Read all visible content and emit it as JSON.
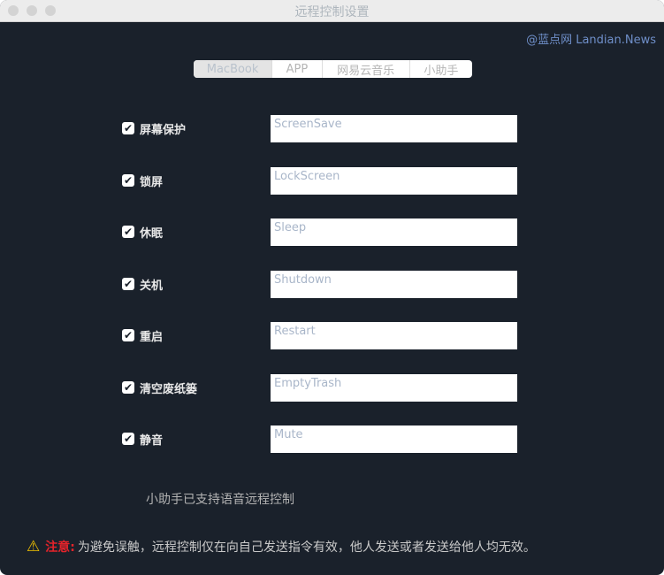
{
  "window": {
    "title": "远程控制设置"
  },
  "watermark": "@蓝点网 Landian.News",
  "tabs": [
    {
      "label": "MacBook",
      "active": true
    },
    {
      "label": "APP"
    },
    {
      "label": "网易云音乐"
    },
    {
      "label": "小助手"
    }
  ],
  "rows": [
    {
      "label": "屏幕保护",
      "checked": true,
      "placeholder": "ScreenSave"
    },
    {
      "label": "锁屏",
      "checked": true,
      "placeholder": "LockScreen"
    },
    {
      "label": "休眠",
      "checked": true,
      "placeholder": "Sleep"
    },
    {
      "label": "关机",
      "checked": true,
      "placeholder": "Shutdown"
    },
    {
      "label": "重启",
      "checked": true,
      "placeholder": "Restart"
    },
    {
      "label": "清空废纸篓",
      "checked": true,
      "placeholder": "EmptyTrash"
    },
    {
      "label": "静音",
      "checked": true,
      "placeholder": "Mute"
    }
  ],
  "check_glyph": "✔",
  "note": "小助手已支持语音远程控制",
  "warning": {
    "icon": "warning-icon",
    "title": "注意:",
    "text": "为避免误触，远程控制仅在向自己发送指令有效，他人发送或者发送给他人均无效。"
  }
}
